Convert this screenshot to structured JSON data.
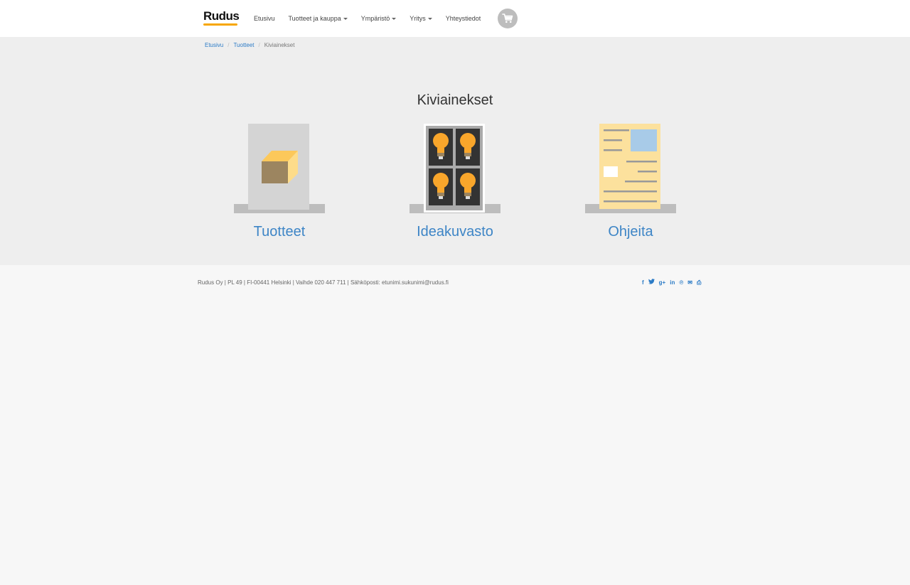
{
  "header": {
    "logo_text": "Rudus",
    "nav": [
      {
        "label": "Etusivu",
        "dropdown": false
      },
      {
        "label": "Tuotteet ja kauppa",
        "dropdown": true
      },
      {
        "label": "Ympäristö",
        "dropdown": true
      },
      {
        "label": "Yritys",
        "dropdown": true
      },
      {
        "label": "Yhteystiedot",
        "dropdown": false
      }
    ],
    "cart_icon": "shopping-cart-icon"
  },
  "breadcrumb": {
    "items": [
      "Etusivu",
      "Tuotteet"
    ],
    "separator": "/",
    "current": "Kiviainekset"
  },
  "page": {
    "title": "Kiviainekset",
    "tiles": [
      {
        "label": "Tuotteet",
        "icon": "product-box-icon"
      },
      {
        "label": "Ideakuvasto",
        "icon": "idea-gallery-icon"
      },
      {
        "label": "Ohjeita",
        "icon": "instructions-document-icon"
      }
    ]
  },
  "footer": {
    "info": "Rudus Oy | PL 49 | FI-00441 Helsinki | Vaihde 020 447 711 | Sähköposti: etunimi.sukunimi@rudus.fi",
    "social": [
      {
        "glyph": "f",
        "icon": "facebook-icon"
      },
      {
        "glyph": "🐦",
        "icon": "twitter-icon"
      },
      {
        "glyph": "g+",
        "icon": "google-plus-icon"
      },
      {
        "glyph": "in",
        "icon": "linkedin-icon"
      },
      {
        "glyph": "℗",
        "icon": "pinterest-icon"
      },
      {
        "glyph": "✉",
        "icon": "email-icon"
      },
      {
        "glyph": "⎙",
        "icon": "print-icon"
      }
    ]
  },
  "colors": {
    "accent_blue": "#3d85c6",
    "link_blue": "#2b7bc6",
    "logo_yellow": "#f7a600",
    "bulb_orange": "#f9a62b",
    "doc_yellow": "#fce19d"
  }
}
